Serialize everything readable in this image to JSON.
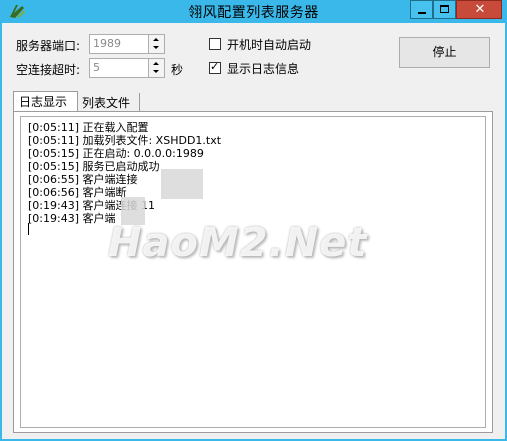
{
  "window": {
    "title": "翎风配置列表服务器",
    "close_glyph": "✕"
  },
  "form": {
    "port_label": "服务器端口:",
    "port_value": "1989",
    "timeout_label": "空连接超时:",
    "timeout_value": "5",
    "timeout_unit": "秒",
    "autostart_label": "开机时自动启动",
    "autostart_checked": false,
    "show_log_label": "显示日志信息",
    "show_log_checked": true,
    "check_mark": "✓",
    "stop_label": "停止"
  },
  "tabs": [
    {
      "label": "日志显示",
      "active": true
    },
    {
      "label": "列表文件",
      "active": false
    }
  ],
  "log_lines": [
    "[0:05:11] 正在载入配置",
    "[0:05:11] 加载列表文件: XSHDD1.txt",
    "[0:05:15] 正在启动: 0.0.0.0:1989",
    "[0:05:15] 服务已启动成功",
    "[0:06:55] 客户端连接",
    "[0:06:56] 客户端断",
    "[0:19:43] 客户端连接 11",
    "[0:19:43] 客户端"
  ],
  "watermark": "HaoM2.Net",
  "colors": {
    "titlebar": "#39b8e9",
    "close_button": "#c74a3a"
  }
}
